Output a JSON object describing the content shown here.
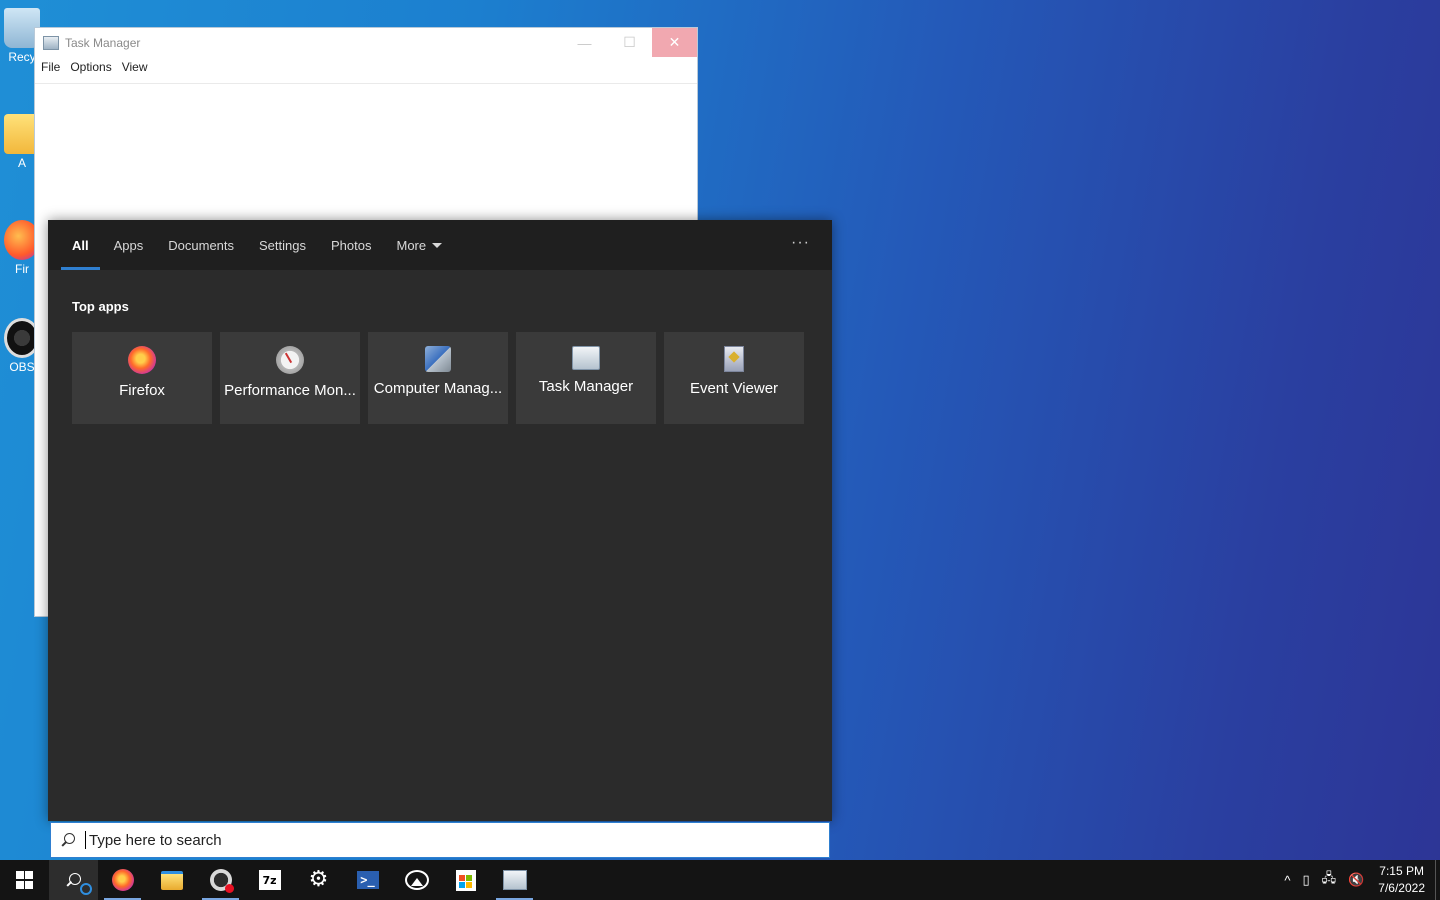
{
  "desktop": {
    "icons": [
      {
        "label": "Recy"
      },
      {
        "label": "A"
      },
      {
        "label": "Fir"
      },
      {
        "label": "OBS"
      }
    ]
  },
  "task_manager": {
    "title": "Task Manager",
    "minimize": "—",
    "maximize": "☐",
    "close": "✕",
    "menu": [
      "File",
      "Options",
      "View"
    ]
  },
  "search": {
    "tabs": [
      {
        "label": "All",
        "active": true
      },
      {
        "label": "Apps"
      },
      {
        "label": "Documents"
      },
      {
        "label": "Settings"
      },
      {
        "label": "Photos"
      },
      {
        "label": "More"
      }
    ],
    "more_options": "···",
    "section_title": "Top apps",
    "top_apps": [
      {
        "label": "Firefox",
        "icon": "firefox-icon"
      },
      {
        "label": "Performance Mon...",
        "icon": "performance-monitor-icon"
      },
      {
        "label": "Computer Manag...",
        "icon": "computer-management-icon"
      },
      {
        "label": "Task Manager",
        "icon": "task-manager-icon"
      },
      {
        "label": "Event Viewer",
        "icon": "event-viewer-icon"
      }
    ],
    "input_placeholder": "Type here to search",
    "input_value": ""
  },
  "taskbar": {
    "apps": [
      "start",
      "search",
      "firefox",
      "file-explorer",
      "obs",
      "7zip",
      "settings",
      "powershell",
      "photos",
      "store",
      "task-manager"
    ],
    "seven_zip_label": "7z",
    "powershell_label": ">_",
    "tray_chevron": "^",
    "clock_time": "7:15 PM",
    "clock_date": "7/6/2022"
  }
}
